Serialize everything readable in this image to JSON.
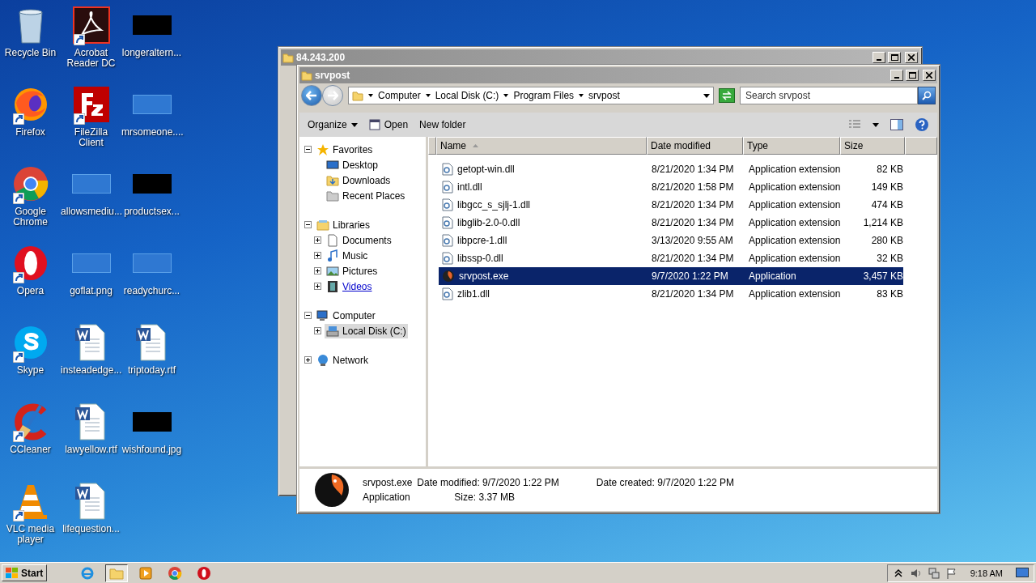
{
  "desktop_icons": [
    {
      "label": "Recycle Bin",
      "kind": "recycle",
      "shortcut": false
    },
    {
      "label": "Acrobat Reader DC",
      "kind": "acrobat",
      "shortcut": true
    },
    {
      "label": "longeraltern...",
      "kind": "black",
      "shortcut": false
    },
    {
      "label": "Firefox",
      "kind": "firefox",
      "shortcut": true
    },
    {
      "label": "FileZilla Client",
      "kind": "filezilla",
      "shortcut": true
    },
    {
      "label": "mrsomeone....",
      "kind": "blank",
      "shortcut": false
    },
    {
      "label": "Google Chrome",
      "kind": "chrome",
      "shortcut": true
    },
    {
      "label": "allowsmediu...",
      "kind": "blank",
      "shortcut": false
    },
    {
      "label": "productsex...",
      "kind": "black",
      "shortcut": false
    },
    {
      "label": "Opera",
      "kind": "opera",
      "shortcut": true
    },
    {
      "label": "goflat.png",
      "kind": "blank",
      "shortcut": false
    },
    {
      "label": "readychurc...",
      "kind": "blank",
      "shortcut": false
    },
    {
      "label": "Skype",
      "kind": "skype",
      "shortcut": true
    },
    {
      "label": "insteadedge...",
      "kind": "word",
      "shortcut": false
    },
    {
      "label": "triptoday.rtf",
      "kind": "word",
      "shortcut": false
    },
    {
      "label": "CCleaner",
      "kind": "ccleaner",
      "shortcut": true
    },
    {
      "label": "lawyellow.rtf",
      "kind": "word",
      "shortcut": false
    },
    {
      "label": "wishfound.jpg",
      "kind": "black",
      "shortcut": false
    },
    {
      "label": "VLC media player",
      "kind": "vlc",
      "shortcut": true
    },
    {
      "label": "lifequestion...",
      "kind": "word",
      "shortcut": false
    }
  ],
  "back_window": {
    "title": "84.243.200"
  },
  "explorer": {
    "title": "srvpost",
    "breadcrumbs": [
      "Computer",
      "Local Disk (C:)",
      "Program Files",
      "srvpost"
    ],
    "search": {
      "placeholder": "Search srvpost"
    },
    "toolbar": [
      {
        "label": "Organize",
        "kind": "menu"
      },
      {
        "label": "Open",
        "kind": "open"
      },
      {
        "label": "New folder",
        "kind": "plain"
      }
    ],
    "nav": [
      {
        "label": "Favorites",
        "kind": "star",
        "expanded": true,
        "selected": false,
        "hovered": false,
        "children": [
          {
            "label": "Desktop",
            "kind": "desktop",
            "selected": false,
            "hovered": false
          },
          {
            "label": "Downloads",
            "kind": "downloads",
            "selected": false,
            "hovered": false
          },
          {
            "label": "Recent Places",
            "kind": "recent",
            "selected": false,
            "hovered": false
          }
        ]
      },
      {
        "label": "Libraries",
        "kind": "library",
        "expanded": true,
        "selected": false,
        "hovered": false,
        "children": [
          {
            "label": "Documents",
            "kind": "documents",
            "expanded": false,
            "selected": false,
            "hovered": false
          },
          {
            "label": "Music",
            "kind": "music",
            "expanded": false,
            "selected": false,
            "hovered": false
          },
          {
            "label": "Pictures",
            "kind": "pictures",
            "expanded": false,
            "selected": false,
            "hovered": false
          },
          {
            "label": "Videos",
            "kind": "videos",
            "expanded": false,
            "selected": false,
            "hovered": true
          }
        ]
      },
      {
        "label": "Computer",
        "kind": "computer",
        "expanded": true,
        "selected": false,
        "hovered": false,
        "children": [
          {
            "label": "Local Disk (C:)",
            "kind": "disk",
            "expanded": false,
            "selected": true,
            "hovered": false
          }
        ]
      },
      {
        "label": "Network",
        "kind": "network",
        "expanded": false,
        "selected": false,
        "hovered": false
      }
    ],
    "columns": [
      {
        "label": "Name",
        "sorted": true
      },
      {
        "label": "Date modified",
        "sorted": false
      },
      {
        "label": "Type",
        "sorted": false
      },
      {
        "label": "Size",
        "sorted": false
      }
    ],
    "files": [
      {
        "name": "getopt-win.dll",
        "kind": "dll",
        "date": "8/21/2020 1:34 PM",
        "type": "Application extension",
        "size": "82 KB",
        "selected": false
      },
      {
        "name": "intl.dll",
        "kind": "dll",
        "date": "8/21/2020 1:58 PM",
        "type": "Application extension",
        "size": "149 KB",
        "selected": false
      },
      {
        "name": "libgcc_s_sjlj-1.dll",
        "kind": "dll",
        "date": "8/21/2020 1:34 PM",
        "type": "Application extension",
        "size": "474 KB",
        "selected": false
      },
      {
        "name": "libglib-2.0-0.dll",
        "kind": "dll",
        "date": "8/21/2020 1:34 PM",
        "type": "Application extension",
        "size": "1,214 KB",
        "selected": false
      },
      {
        "name": "libpcre-1.dll",
        "kind": "dll",
        "date": "3/13/2020 9:55 AM",
        "type": "Application extension",
        "size": "280 KB",
        "selected": false
      },
      {
        "name": "libssp-0.dll",
        "kind": "dll",
        "date": "8/21/2020 1:34 PM",
        "type": "Application extension",
        "size": "32 KB",
        "selected": false
      },
      {
        "name": "srvpost.exe",
        "kind": "exe",
        "date": "9/7/2020 1:22 PM",
        "type": "Application",
        "size": "3,457 KB",
        "selected": true
      },
      {
        "name": "zlib1.dll",
        "kind": "dll",
        "date": "8/21/2020 1:34 PM",
        "type": "Application extension",
        "size": "83 KB",
        "selected": false
      }
    ],
    "details": {
      "name": "srvpost.exe",
      "type": "Application",
      "modified_label": "Date modified:",
      "modified": "9/7/2020 1:22 PM",
      "created_label": "Date created:",
      "created": "9/7/2020 1:22 PM",
      "size_label": "Size:",
      "size": "3.37 MB"
    }
  },
  "taskbar": {
    "start": "Start",
    "apps": [
      {
        "kind": "ie",
        "pressed": false
      },
      {
        "kind": "explorer",
        "pressed": true
      },
      {
        "kind": "media",
        "pressed": false
      },
      {
        "kind": "chrome",
        "pressed": false
      },
      {
        "kind": "opera",
        "pressed": false
      }
    ],
    "clock": "9:18 AM"
  }
}
